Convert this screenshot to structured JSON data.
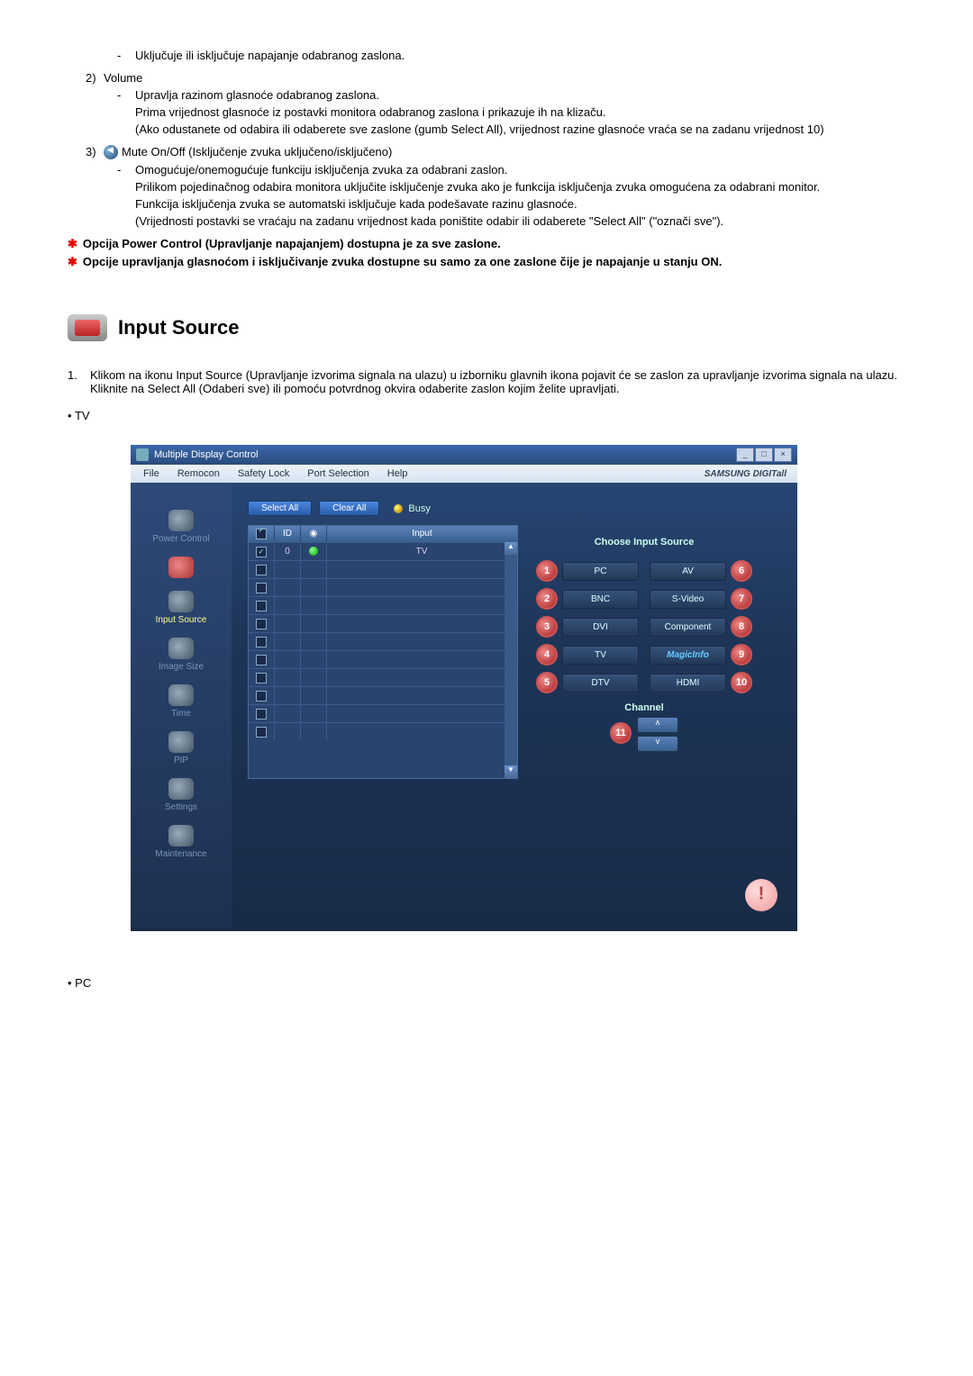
{
  "list_pre": {
    "power_desc": "Uključuje ili isključuje napajanje odabranog zaslona."
  },
  "list_items": [
    {
      "num": "2)",
      "title": "Volume",
      "lines": [
        "Upravlja razinom glasnoće odabranog zaslona.",
        "Prima vrijednost glasnoće iz postavki monitora odabranog zaslona i prikazuje ih na klizaču.",
        "(Ako odustanete od odabira ili odaberete sve zaslone (gumb Select All), vrijednost razine glasnoće vraća se na zadanu vrijednost 10)"
      ]
    },
    {
      "num": "3)",
      "title": "Mute On/Off (Isključenje zvuka uključeno/isključeno)",
      "has_mute_icon": true,
      "lines": [
        "Omogućuje/onemogućuje funkciju isključenja zvuka za odabrani zaslon.",
        "Prilikom pojedinačnog odabira monitora uključite isključenje zvuka ako je funkcija isključenja zvuka omogućena za odabrani monitor.",
        "Funkcija isključenja zvuka se automatski isključuje kada podešavate razinu glasnoće.",
        "(Vrijednosti postavki se vraćaju na zadanu vrijednost kada poništite odabir ili odaberete \"Select All\" (\"označi sve\")."
      ]
    }
  ],
  "star_notes": [
    "Opcija Power Control (Upravljanje napajanjem) dostupna je za sve zaslone.",
    "Opcije upravljanja glasnoćom i isključivanje zvuka dostupne su samo za one zaslone čije je napajanje u stanju ON."
  ],
  "section_title": "Input Source",
  "intro": {
    "num": "1.",
    "text1": "Klikom na ikonu Input Source (Upravljanje izvorima signala na ulazu) u izborniku glavnih ikona pojavit će se zaslon za upravljanje izvorima signala na ulazu.",
    "text2": "Kliknite na Select All (Odaberi sve) ili pomoću potvrdnog okvira odaberite zaslon kojim želite upravljati."
  },
  "bullet_tv": "TV",
  "bullet_pc": "PC",
  "app": {
    "window_title": "Multiple Display Control",
    "menus": [
      "File",
      "Remocon",
      "Safety Lock",
      "Port Selection",
      "Help"
    ],
    "brand": "SAMSUNG DIGITall",
    "sidebar": [
      {
        "label": "Power Control",
        "cls": ""
      },
      {
        "label": "",
        "cls": "red"
      },
      {
        "label": "Input Source",
        "cls": "active"
      },
      {
        "label": "Image Size",
        "cls": ""
      },
      {
        "label": "Time",
        "cls": ""
      },
      {
        "label": "PIP",
        "cls": ""
      },
      {
        "label": "Settings",
        "cls": ""
      },
      {
        "label": "Maintenance",
        "cls": ""
      }
    ],
    "select_all": "Select All",
    "clear_all": "Clear All",
    "busy": "Busy",
    "table_headers": {
      "chk": "☑",
      "id": "ID",
      "status": "",
      "input": "Input"
    },
    "first_row": {
      "id": "0",
      "input": "TV"
    },
    "right_title": "Choose Input Source",
    "sources": [
      {
        "n": "1",
        "label": "PC"
      },
      {
        "n": "6",
        "label": "AV"
      },
      {
        "n": "2",
        "label": "BNC"
      },
      {
        "n": "7",
        "label": "S-Video"
      },
      {
        "n": "3",
        "label": "DVI"
      },
      {
        "n": "8",
        "label": "Component"
      },
      {
        "n": "4",
        "label": "TV"
      },
      {
        "n": "9",
        "label": "MagicInfo",
        "magic": true
      },
      {
        "n": "5",
        "label": "DTV"
      },
      {
        "n": "10",
        "label": "HDMI"
      }
    ],
    "channel": "Channel",
    "channel_badge": "11"
  }
}
